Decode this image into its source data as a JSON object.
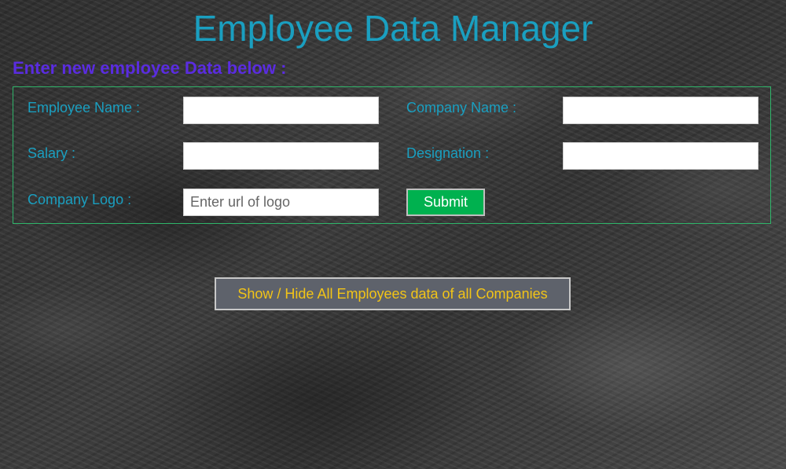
{
  "header": {
    "title": "Employee Data Manager",
    "subtitle": "Enter new employee Data below :"
  },
  "form": {
    "employee_name_label": "Employee Name :",
    "employee_name_value": "",
    "company_name_label": "Company Name :",
    "company_name_value": "",
    "salary_label": "Salary :",
    "salary_value": "",
    "designation_label": "Designation :",
    "designation_value": "",
    "company_logo_label": "Company Logo :",
    "company_logo_placeholder": "Enter url of logo",
    "company_logo_value": "",
    "submit_label": "Submit"
  },
  "actions": {
    "toggle_label": "Show / Hide All Employees data of all Companies"
  },
  "colors": {
    "title": "#1a9fc0",
    "subtitle": "#5a2ce0",
    "form_border": "#2fb56a",
    "submit_bg": "#00b14f",
    "toggle_bg": "#5e626b",
    "toggle_text": "#f2c417"
  }
}
